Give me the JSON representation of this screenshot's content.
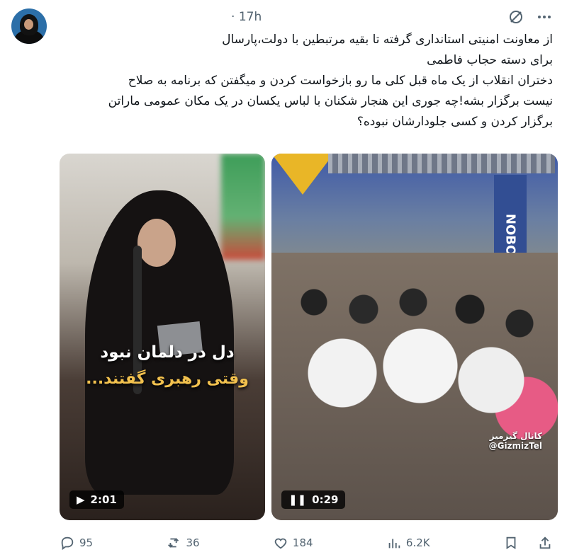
{
  "post": {
    "time": "17h",
    "text_lines": [
      "از معاونت امنیتی استانداری گرفته تا بقیه مرتبطین با دولت،پارسال",
      "برای دسته حجاب فاطمی",
      "دختران انقلاب از یک ماه قبل کلی ما رو بازخواست کردن و میگفتن که برنامه به صلاح",
      "نیست برگزار بشه!چه جوری این هنجار شکنان با لباس یکسان در یک مکان عمومی ماراتن",
      "برگزار کردن و کسی جلودارشان نبوده؟"
    ]
  },
  "media": [
    {
      "overlay_line1": "دل در دلمان نبود",
      "overlay_line2": "وقتی رهبری گفتند...",
      "duration": "2:01",
      "control": "play"
    },
    {
      "duration": "0:29",
      "control": "pause",
      "banner_text": "NOBO",
      "watermark": [
        "کانال گیزمیز",
        "@GizmizTel"
      ]
    }
  ],
  "actions": {
    "replies": "95",
    "reposts": "36",
    "likes": "184",
    "views": "6.2K"
  },
  "icons": [
    "grok-icon",
    "more-icon",
    "reply-icon",
    "repost-icon",
    "like-icon",
    "views-icon",
    "bookmark-icon",
    "share-icon"
  ],
  "colors": {
    "text": "#0f1419",
    "muted": "#536471",
    "background": "#ffffff"
  }
}
